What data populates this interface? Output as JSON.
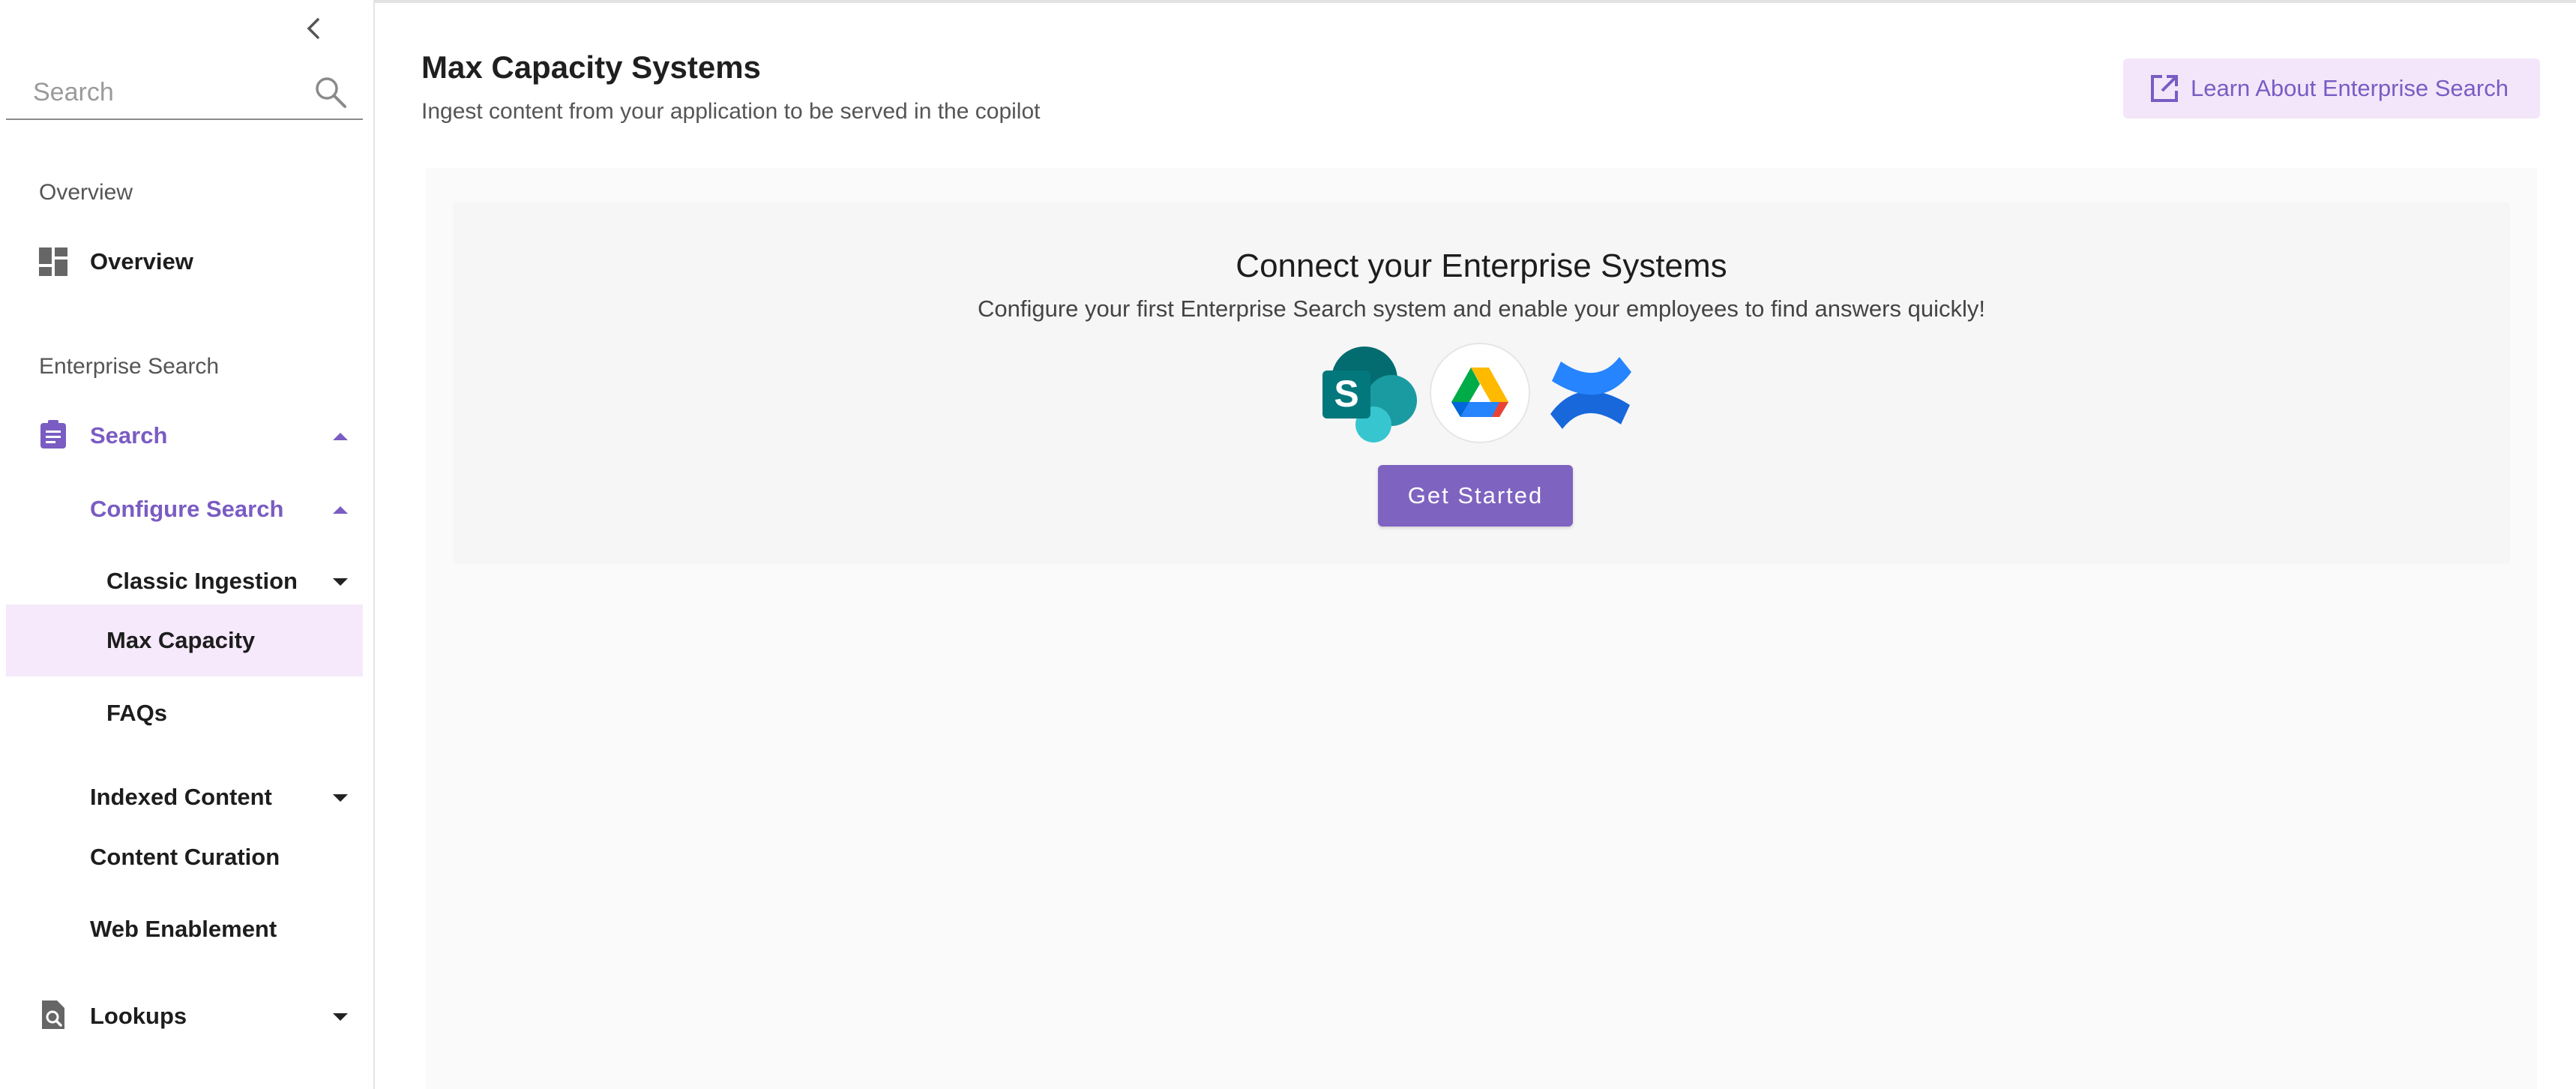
{
  "sidebar": {
    "search_placeholder": "Search",
    "sections": {
      "overview_label": "Overview",
      "enterprise_label": "Enterprise Search"
    },
    "items": {
      "overview": "Overview",
      "search": "Search",
      "configure_search": "Configure Search",
      "classic_ingestion": "Classic Ingestion",
      "max_capacity": "Max Capacity",
      "faqs": "FAQs",
      "indexed_content": "Indexed Content",
      "content_curation": "Content Curation",
      "web_enablement": "Web Enablement",
      "lookups": "Lookups"
    }
  },
  "header": {
    "title": "Max Capacity Systems",
    "subtitle": "Ingest content from your application to be served in the copilot",
    "learn_button": "Learn About Enterprise Search"
  },
  "connect": {
    "title": "Connect your Enterprise Systems",
    "description": "Configure your first Enterprise Search system and enable your employees to find answers quickly!",
    "button": "Get Started",
    "logos": [
      "sharepoint-icon",
      "google-drive-icon",
      "confluence-icon"
    ]
  },
  "colors": {
    "accent": "#7a5cc3",
    "selected_bg": "#f5e9fb",
    "button_bg": "#7e63c0"
  }
}
